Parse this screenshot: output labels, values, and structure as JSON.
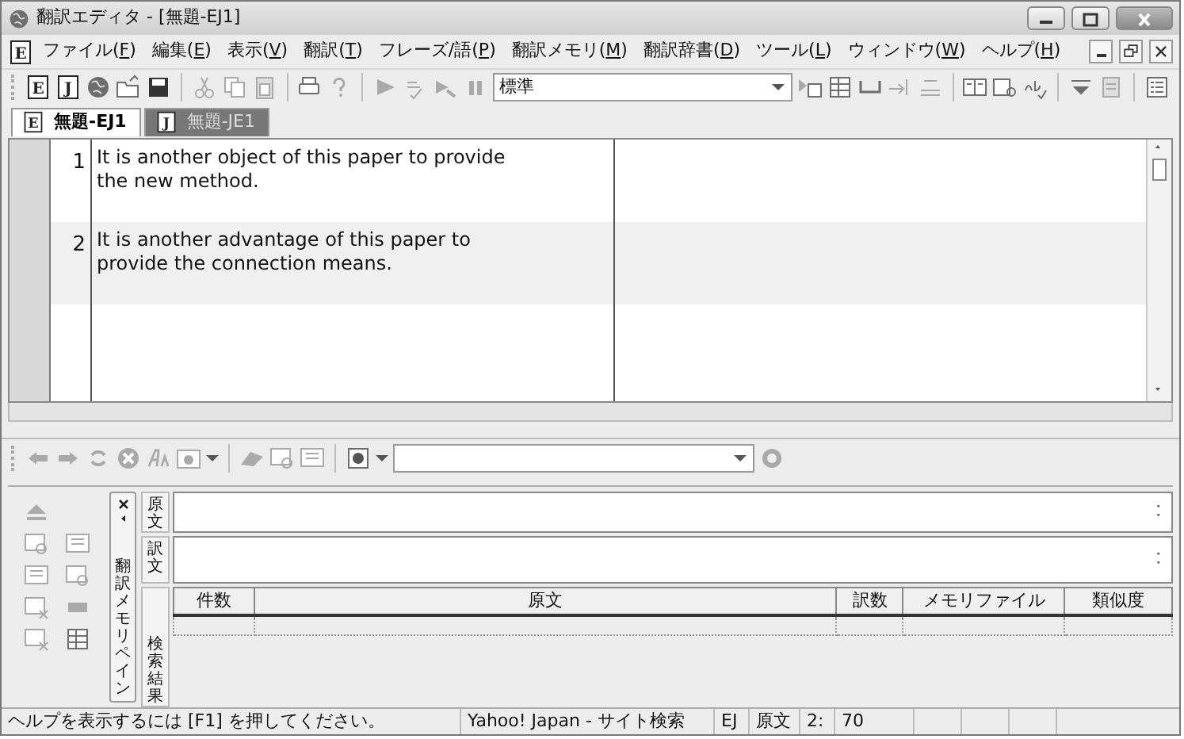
{
  "window": {
    "title": "翻訳エディタ - [無題-EJ1]"
  },
  "menu": {
    "doc_letter": "E",
    "items": [
      {
        "before": "ファイル(",
        "key": "F",
        "after": ")"
      },
      {
        "before": "編集(",
        "key": "E",
        "after": ")"
      },
      {
        "before": "表示(",
        "key": "V",
        "after": ")"
      },
      {
        "before": "翻訳(",
        "key": "T",
        "after": ")"
      },
      {
        "before": "フレーズ/語(",
        "key": "P",
        "after": ")"
      },
      {
        "before": "翻訳メモリ(",
        "key": "M",
        "after": ")"
      },
      {
        "before": "翻訳辞書(",
        "key": "D",
        "after": ")"
      },
      {
        "before": "ツール(",
        "key": "L",
        "after": ")"
      },
      {
        "before": "ウィンドウ(",
        "key": "W",
        "after": ")"
      },
      {
        "before": "ヘルプ(",
        "key": "H",
        "after": ")"
      }
    ]
  },
  "toolbar": {
    "doc_letters": [
      "E",
      "J"
    ],
    "mode_value": "標準"
  },
  "tabs": [
    {
      "letter": "E",
      "label": "無題-EJ1",
      "selected": true
    },
    {
      "letter": "J",
      "label": "無題-JE1",
      "selected": false
    }
  ],
  "editor": {
    "rows": [
      {
        "number": "1",
        "source": "It is another object of this paper to provide the new method.",
        "selected": false
      },
      {
        "number": "2",
        "source": "It is another advantage of this paper to provide the connection means.",
        "selected": true
      }
    ]
  },
  "memory_pane": {
    "tab_label": "翻訳メモリペイン",
    "source_label": "原文",
    "target_label": "訳文",
    "results_label": "検索結果",
    "columns": [
      "件数",
      "原文",
      "訳数",
      "メモリファイル",
      "類似度"
    ]
  },
  "status_bar": {
    "help": "ヘルプを表示するには [F1] を押してください。",
    "search": "Yahoo! Japan - サイト検索",
    "direction": "EJ",
    "field": "原文",
    "line": "2:",
    "column": "70"
  }
}
